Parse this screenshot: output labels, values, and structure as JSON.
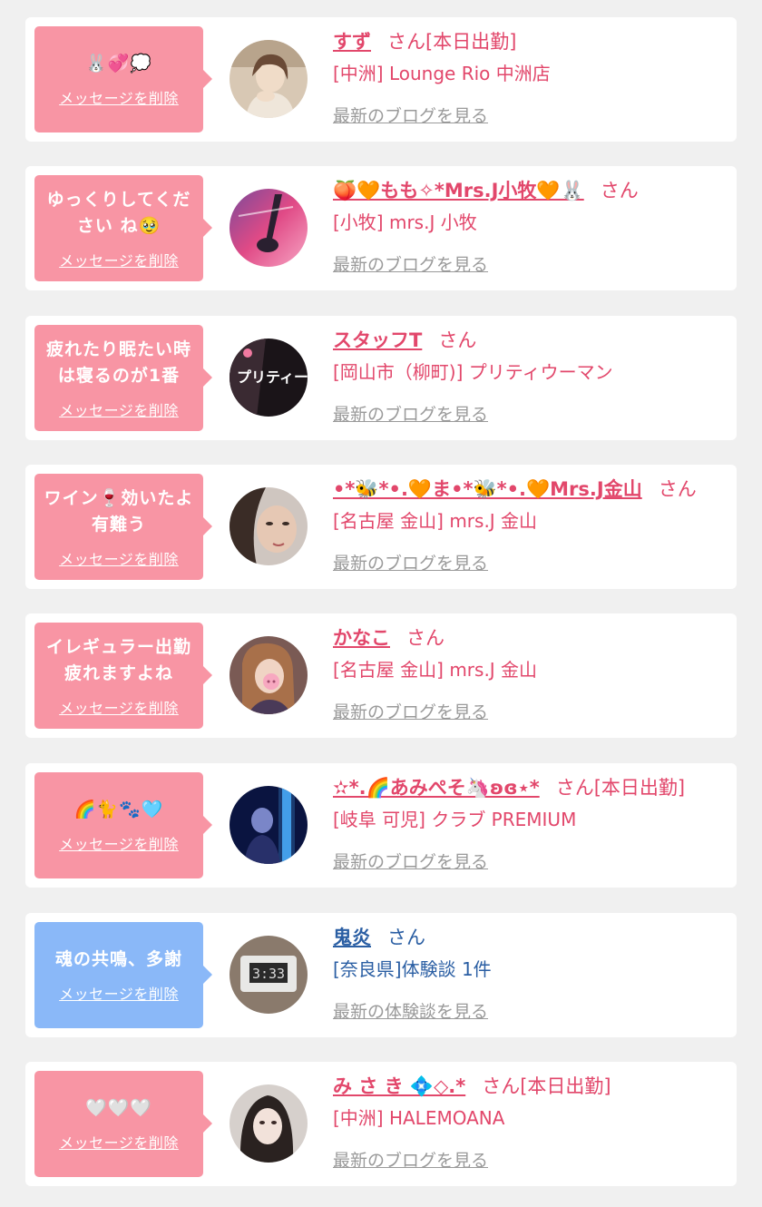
{
  "cards": [
    {
      "theme": "pink",
      "message": "🐰💞💭",
      "delete_label": "メッセージを削除",
      "name": "すず",
      "san": "さん[本日出勤]",
      "shop": "[中洲] Lounge Rio 中洲店",
      "link": "最新のブログを見る",
      "avatar_icon": "woman-portrait-avatar"
    },
    {
      "theme": "pink",
      "message": "ゆっくりしてください ね🥹",
      "delete_label": "メッセージを削除",
      "name": "🍑🧡もも✧*Mrs.J小牧🧡🐰",
      "san": "さん",
      "shop": "[小牧] mrs.J 小牧",
      "link": "最新のブログを見る",
      "avatar_icon": "pink-mirror-photo-avatar"
    },
    {
      "theme": "pink",
      "message": "疲れたり眠たい時 は寝るのが1番",
      "delete_label": "メッセージを削除",
      "name": "スタッフT",
      "san": "さん",
      "shop": "[岡山市（柳町)] プリティウーマン",
      "link": "最新のブログを見る",
      "avatar_icon": "pretty-woman-logo-avatar",
      "avatar_text": "プリティーウーマ"
    },
    {
      "theme": "pink",
      "message": "ワイン🍷効いたよ 有難う",
      "delete_label": "メッセージを削除",
      "name": "•*🐝*•.🧡ま•*🐝*•.🧡Mrs.J金山",
      "san": "さん",
      "shop": "[名古屋 金山] mrs.J 金山",
      "link": "最新のブログを見る",
      "avatar_icon": "woman-face-avatar"
    },
    {
      "theme": "pink",
      "message": "イレギュラー出勤 疲れますよね",
      "delete_label": "メッセージを削除",
      "name": "かなこ",
      "san": "さん",
      "shop": "[名古屋 金山] mrs.J 金山",
      "link": "最新のブログを見る",
      "avatar_icon": "woman-pig-sticker-avatar"
    },
    {
      "theme": "pink",
      "message": "🌈🐈🐾🩵",
      "delete_label": "メッセージを削除",
      "name": "✫*.🌈あみぺそ🦄ʚɞ⋆*",
      "san": "さん[本日出勤]",
      "shop": "[岐阜 可児] クラブ PREMIUM",
      "link": "最新のブログを見る",
      "avatar_icon": "blue-light-woman-avatar"
    },
    {
      "theme": "blue",
      "message": "魂の共鳴、多謝",
      "delete_label": "メッセージを削除",
      "name": "鬼炎",
      "san": "さん",
      "shop": "[奈良県]体験談 1件",
      "link": "最新の体験談を見る",
      "avatar_icon": "digital-clock-avatar",
      "avatar_text": "3:33"
    },
    {
      "theme": "pink",
      "message": "🤍🤍🤍",
      "delete_label": "メッセージを削除",
      "name": "み さ き 💠◇.*",
      "san": "さん[本日出勤]",
      "shop": "[中洲] HALEMOANA",
      "link": "最新のブログを見る",
      "avatar_icon": "dark-hair-woman-avatar"
    }
  ],
  "colors": {
    "bubble_pink": "#f895a4",
    "bubble_blue": "#8ab8f8",
    "text_pink": "#e2476b",
    "text_blue": "#2a5ea3",
    "link_gray": "#9a9a9a",
    "background": "#f0f0f0"
  }
}
